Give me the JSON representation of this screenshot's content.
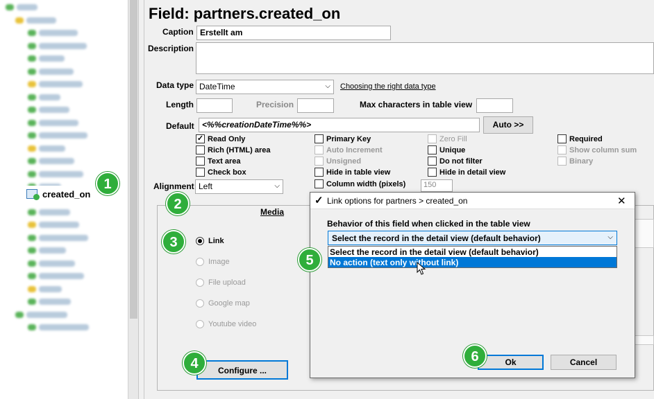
{
  "tree": {
    "selected_item": "created_on",
    "blurred_rows": 25
  },
  "field": {
    "title": "Field: partners.created_on",
    "caption_label": "Caption",
    "caption_value": "Erstellt am",
    "description_label": "Description",
    "description_value": "",
    "datatype_label": "Data type",
    "datatype_value": "DateTime",
    "datatype_link": "Choosing the right data type",
    "length_label": "Length",
    "length_value": "",
    "precision_label": "Precision",
    "precision_value": "",
    "maxchars_label": "Max characters in table view",
    "maxchars_value": "",
    "default_label": "Default",
    "default_value": "<%%creationDateTime%%>",
    "auto_button": "Auto >>",
    "alignment_label": "Alignment",
    "alignment_value": "Left",
    "column_width_value": "150"
  },
  "checkboxes": {
    "read_only": {
      "label": "Read Only",
      "checked": "✓"
    },
    "rich_html": {
      "label": "Rich (HTML) area",
      "checked": ""
    },
    "text_area": {
      "label": "Text area",
      "checked": ""
    },
    "check_box": {
      "label": "Check box",
      "checked": ""
    },
    "primary_key": {
      "label": "Primary Key",
      "checked": ""
    },
    "auto_increment": {
      "label": "Auto Increment",
      "checked": ""
    },
    "unsigned": {
      "label": "Unsigned",
      "checked": ""
    },
    "hide_table": {
      "label": "Hide in table view",
      "checked": ""
    },
    "column_width": {
      "label": "Column width (pixels)",
      "checked": ""
    },
    "zero_fill": {
      "label": "Zero Fill",
      "checked": ""
    },
    "unique": {
      "label": "Unique",
      "checked": ""
    },
    "do_not_filter": {
      "label": "Do not filter",
      "checked": ""
    },
    "hide_detail": {
      "label": "Hide in detail view",
      "checked": ""
    },
    "required": {
      "label": "Required",
      "checked": ""
    },
    "show_column_sum": {
      "label": "Show column sum",
      "checked": ""
    },
    "binary": {
      "label": "Binary",
      "checked": ""
    }
  },
  "media": {
    "tab_label": "Media",
    "options": {
      "link": "Link",
      "image": "Image",
      "file_upload": "File upload",
      "google_map": "Google map",
      "youtube_video": "Youtube video"
    },
    "configure_button": "Configure ..."
  },
  "dialog": {
    "title": "Link options for partners > created_on",
    "close_glyph": "✕",
    "behavior_label": "Behavior of this field when clicked in the table view",
    "selected_value": "Select the record in the detail view (default behavior)",
    "options": [
      "Select the record in the detail view (default behavior)",
      "No action (text only without link)"
    ],
    "ok_button": "Ok",
    "cancel_button": "Cancel"
  },
  "badges": [
    "1",
    "2",
    "3",
    "4",
    "5",
    "6"
  ],
  "colors": {
    "badge_green": "#2fae3b",
    "highlight_blue": "#0078d7",
    "dialog_border": "#6a6a6a"
  }
}
